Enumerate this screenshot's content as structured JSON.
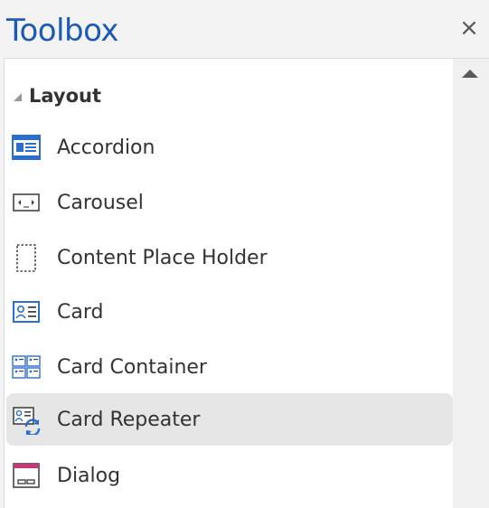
{
  "header": {
    "title": "Toolbox",
    "close_label": "×"
  },
  "section": {
    "label": "Layout"
  },
  "items": [
    {
      "label": "Accordion",
      "icon": "accordion-icon",
      "selected": false
    },
    {
      "label": "Carousel",
      "icon": "carousel-icon",
      "selected": false
    },
    {
      "label": "Content Place Holder",
      "icon": "content-placeholder-icon",
      "selected": false
    },
    {
      "label": "Card",
      "icon": "card-icon",
      "selected": false
    },
    {
      "label": "Card Container",
      "icon": "card-container-icon",
      "selected": false
    },
    {
      "label": "Card Repeater",
      "icon": "card-repeater-icon",
      "selected": true
    },
    {
      "label": "Dialog",
      "icon": "dialog-icon",
      "selected": false
    }
  ],
  "colors": {
    "accent": "#1c5bb5",
    "icon_blue": "#2a6fcf",
    "selected_bg": "#e6e6e6"
  }
}
